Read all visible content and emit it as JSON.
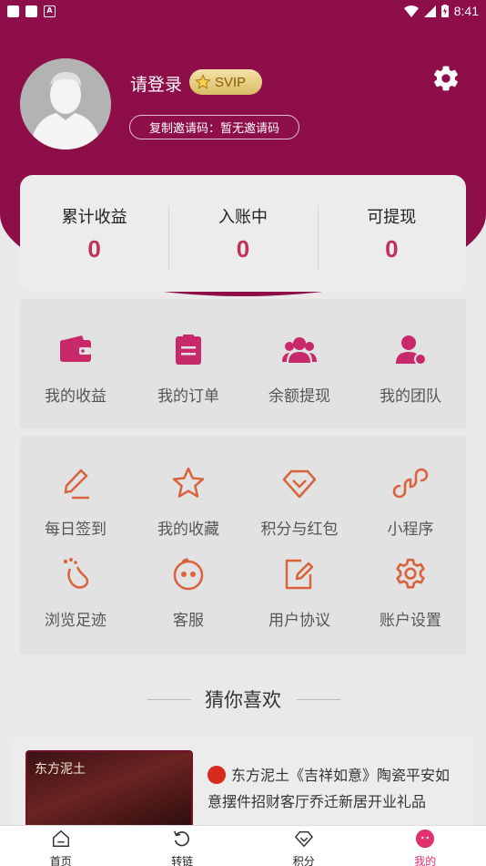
{
  "status_bar": {
    "time": "8:41"
  },
  "profile": {
    "username": "请登录",
    "badge": "SVIP",
    "invite_text": "复制邀请码：暂无邀请码"
  },
  "stats": [
    {
      "label": "累计收益",
      "value": "0"
    },
    {
      "label": "入账中",
      "value": "0"
    },
    {
      "label": "可提现",
      "value": "0"
    }
  ],
  "menu_primary": [
    {
      "label": "我的收益",
      "icon": "wallet-icon"
    },
    {
      "label": "我的订单",
      "icon": "clipboard-icon"
    },
    {
      "label": "余额提现",
      "icon": "group-icon"
    },
    {
      "label": "我的团队",
      "icon": "user-icon"
    }
  ],
  "menu_secondary": [
    {
      "label": "每日签到",
      "icon": "pen-icon"
    },
    {
      "label": "我的收藏",
      "icon": "star-icon"
    },
    {
      "label": "积分与红包",
      "icon": "diamond-icon"
    },
    {
      "label": "小程序",
      "icon": "miniprogram-icon"
    },
    {
      "label": "浏览足迹",
      "icon": "footprint-icon"
    },
    {
      "label": "客服",
      "icon": "service-icon"
    },
    {
      "label": "用户协议",
      "icon": "agreement-icon"
    },
    {
      "label": "账户设置",
      "icon": "settings-icon"
    }
  ],
  "recommend": {
    "title": "猜你喜欢",
    "products": [
      {
        "image_text": "东方泥土",
        "title": "东方泥土《吉祥如意》陶瓷平安如意摆件招财客厅乔迁新居开业礼品"
      }
    ]
  },
  "bottom_nav": [
    {
      "label": "首页",
      "icon": "home-icon"
    },
    {
      "label": "转链",
      "icon": "refresh-icon"
    },
    {
      "label": "积分",
      "icon": "points-icon"
    },
    {
      "label": "我的",
      "icon": "profile-icon",
      "active": true
    }
  ],
  "colors": {
    "header": "#8d0e48",
    "primary_icon": "#c7296a",
    "secondary_icon": "#d9633c",
    "stat_value": "#c0305a",
    "active_nav": "#e0306e"
  }
}
